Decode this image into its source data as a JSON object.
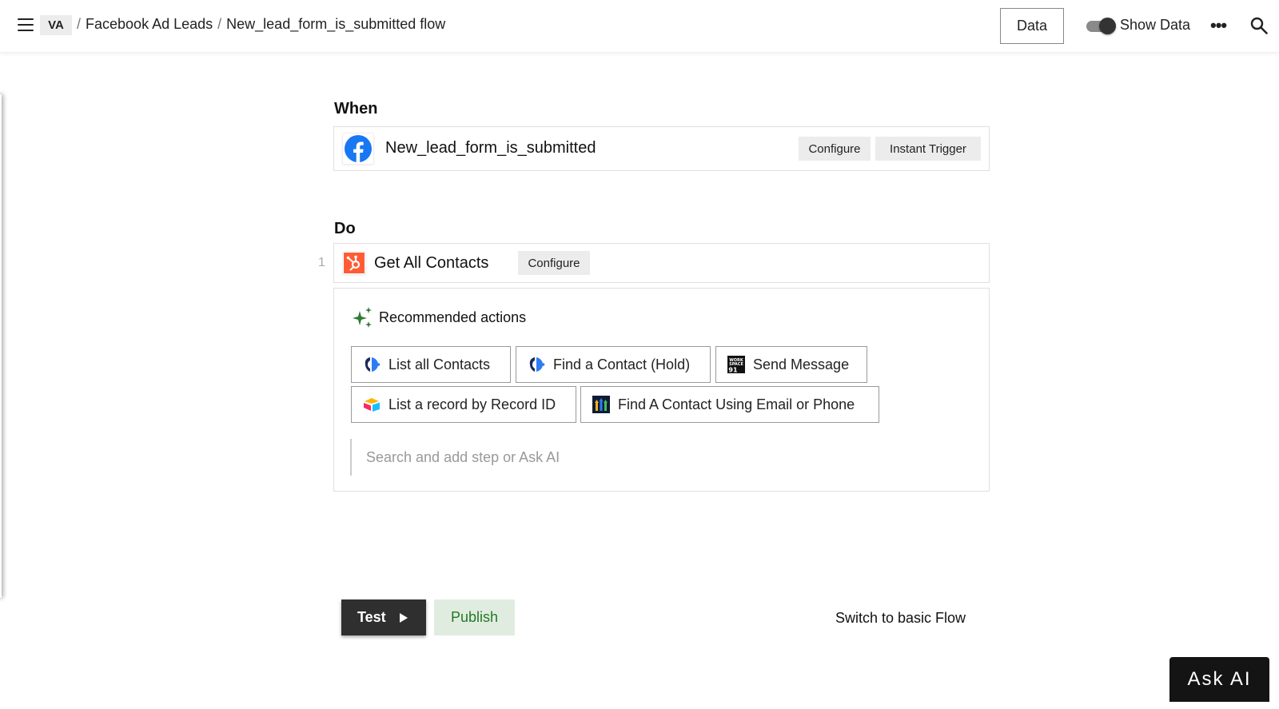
{
  "header": {
    "workspace_badge": "VA",
    "breadcrumb": [
      {
        "label": "Facebook Ad Leads"
      },
      {
        "label": "New_lead_form_is_submitted flow"
      }
    ],
    "separator": "/",
    "data_button": "Data",
    "show_data_label": "Show Data",
    "show_data_on": true,
    "icons": {
      "menu": "hamburger-icon",
      "more": "more-icon",
      "search": "search-icon"
    }
  },
  "when": {
    "label": "When",
    "trigger": {
      "app_icon": "facebook-icon",
      "name": "New_lead_form_is_submitted",
      "configure_label": "Configure",
      "trigger_type": "Instant Trigger"
    }
  },
  "do": {
    "label": "Do",
    "steps": [
      {
        "number": "1",
        "app_icon": "hubspot-icon",
        "name": "Get All Contacts",
        "configure_label": "Configure"
      }
    ]
  },
  "recommended": {
    "title": "Recommended actions",
    "icon": "sparkle-icon",
    "actions": [
      {
        "label": "List all Contacts",
        "icon": "app-logo-icon"
      },
      {
        "label": "Find a Contact (Hold)",
        "icon": "app-logo-icon"
      },
      {
        "label": "Send Message",
        "icon": "workspace91-icon"
      },
      {
        "label": "List a record by Record ID",
        "icon": "airtable-icon"
      },
      {
        "label": "Find A Contact Using Email or Phone",
        "icon": "gohighlevel-icon"
      }
    ],
    "search_placeholder": "Search and add step or Ask AI",
    "search_value": ""
  },
  "footer": {
    "test_label": "Test",
    "publish_label": "Publish",
    "switch_label": "Switch to basic Flow",
    "ask_ai_label": "Ask AI"
  },
  "colors": {
    "facebook": "#1877F2",
    "hubspot": "#FF5C35",
    "sparkle": "#2E7D32",
    "publish_bg": "#E1ECE1",
    "publish_text": "#237A23",
    "test_bg": "#2F2F2F"
  }
}
